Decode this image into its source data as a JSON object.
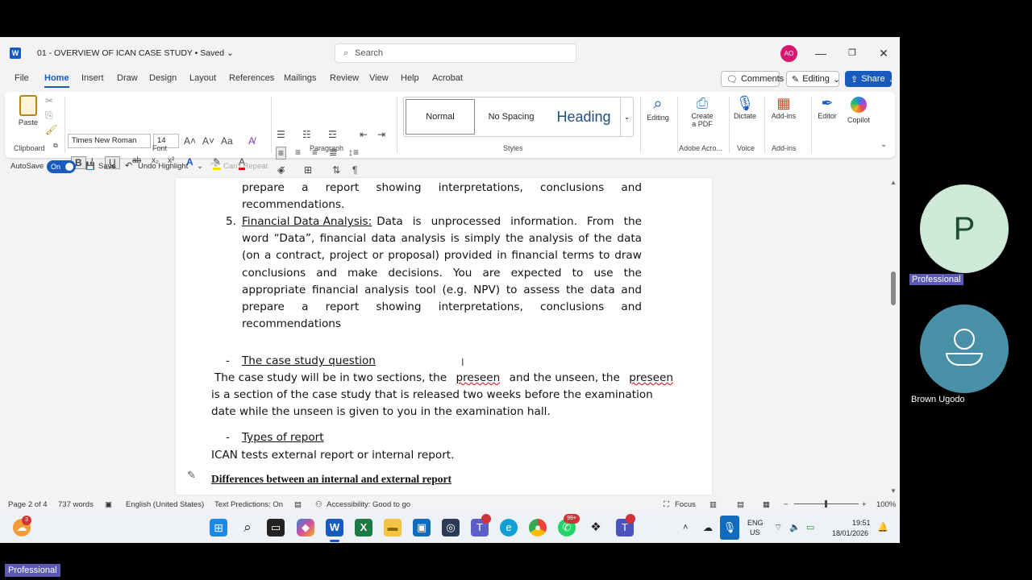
{
  "overlay": {
    "recorder": "screenrec",
    "participants": [
      {
        "initial": "P",
        "label": "Professional"
      },
      {
        "initial": "",
        "label": "Brown Ugodo"
      }
    ],
    "bottom_label": "Professional"
  },
  "titlebar": {
    "doc_title": "01 - OVERVIEW OF ICAN CASE STUDY",
    "saved": "• Saved",
    "search_placeholder": "Search",
    "avatar": "AO"
  },
  "tabs": [
    "File",
    "Home",
    "Insert",
    "Draw",
    "Design",
    "Layout",
    "References",
    "Mailings",
    "Review",
    "View",
    "Help",
    "Acrobat"
  ],
  "actions": {
    "comments": "Comments",
    "editing": "Editing",
    "share": "Share"
  },
  "ribbon": {
    "clipboard": {
      "paste": "Paste",
      "label": "Clipboard"
    },
    "font": {
      "family": "Times New Roman",
      "size": "14",
      "label": "Font"
    },
    "paragraph": {
      "label": "Paragraph"
    },
    "styles": {
      "normal": "Normal",
      "no_spacing": "No Spacing",
      "heading": "Heading",
      "label": "Styles"
    },
    "editing": "Editing",
    "create_pdf_1": "Create",
    "create_pdf_2": "a PDF",
    "adobe_label": "Adobe Acro...",
    "dictate": "Dictate",
    "voice_label": "Voice",
    "addins": "Add-ins",
    "addins_label": "Add-ins",
    "editor": "Editor",
    "copilot": "Copilot"
  },
  "qat": {
    "autosave": "AutoSave",
    "autosave_state": "On",
    "save": "Save",
    "undo": "Undo Highlight",
    "redo": "Can't Repeat"
  },
  "document": {
    "l1": [
      "prepare",
      "a",
      "report",
      "showing",
      "interpretations,",
      "conclusions",
      "and"
    ],
    "l2": "recommendations.",
    "item5_num": "5.",
    "item5_head": "Financial Data Analysis:",
    "l3_rest": [
      "Data",
      "is",
      "unprocessed",
      "information.",
      "From",
      "the"
    ],
    "l4": [
      "word",
      "“Data”,",
      "financial",
      "data",
      "analysis",
      "is",
      "simply",
      "the",
      "analysis",
      "of",
      "the",
      "data"
    ],
    "l5": [
      "(on",
      "a",
      "contract,",
      "project",
      "or",
      "proposal)",
      "provided",
      "in",
      "financial",
      "terms",
      "to",
      "draw"
    ],
    "l6": [
      "conclusions",
      "and",
      "make",
      "decisions.",
      "You",
      "are",
      "expected",
      "to",
      "use",
      "the"
    ],
    "l7": [
      "appropriate",
      "financial",
      "analysis",
      "tool",
      "(e.g.",
      "NPV)",
      "to",
      "assess",
      "the",
      "data",
      "and"
    ],
    "l8": [
      "prepare",
      "a",
      "report",
      "showing",
      "interpretations,",
      "conclusions",
      "and"
    ],
    "l9": "recommendations",
    "bullet": "-",
    "case_q": "The case study question",
    "p1_a": "The case study will be in two sections, the",
    "p1_b": "preseen",
    "p1_c": "and the unseen, the",
    "p1_d": "preseen",
    "p2": "is a section of the case study that is released two weeks before the examination",
    "p3": "date while the unseen is given to you in the examination hall.",
    "types": "Types of report",
    "p4": "ICAN tests external report or internal report.",
    "diff": "Differences between an internal and external report"
  },
  "status": {
    "page": "Page 2 of 4",
    "words": "737 words",
    "lang": "English (United States)",
    "predictions": "Text Predictions: On",
    "access": "Accessibility: Good to go",
    "focus": "Focus",
    "zoom": "100%"
  },
  "taskbar": {
    "badges": {
      "b1": "3",
      "b2": "99+"
    },
    "lang1": "ENG",
    "lang2": "US",
    "time": "19:51",
    "date": "18/01/2026"
  }
}
